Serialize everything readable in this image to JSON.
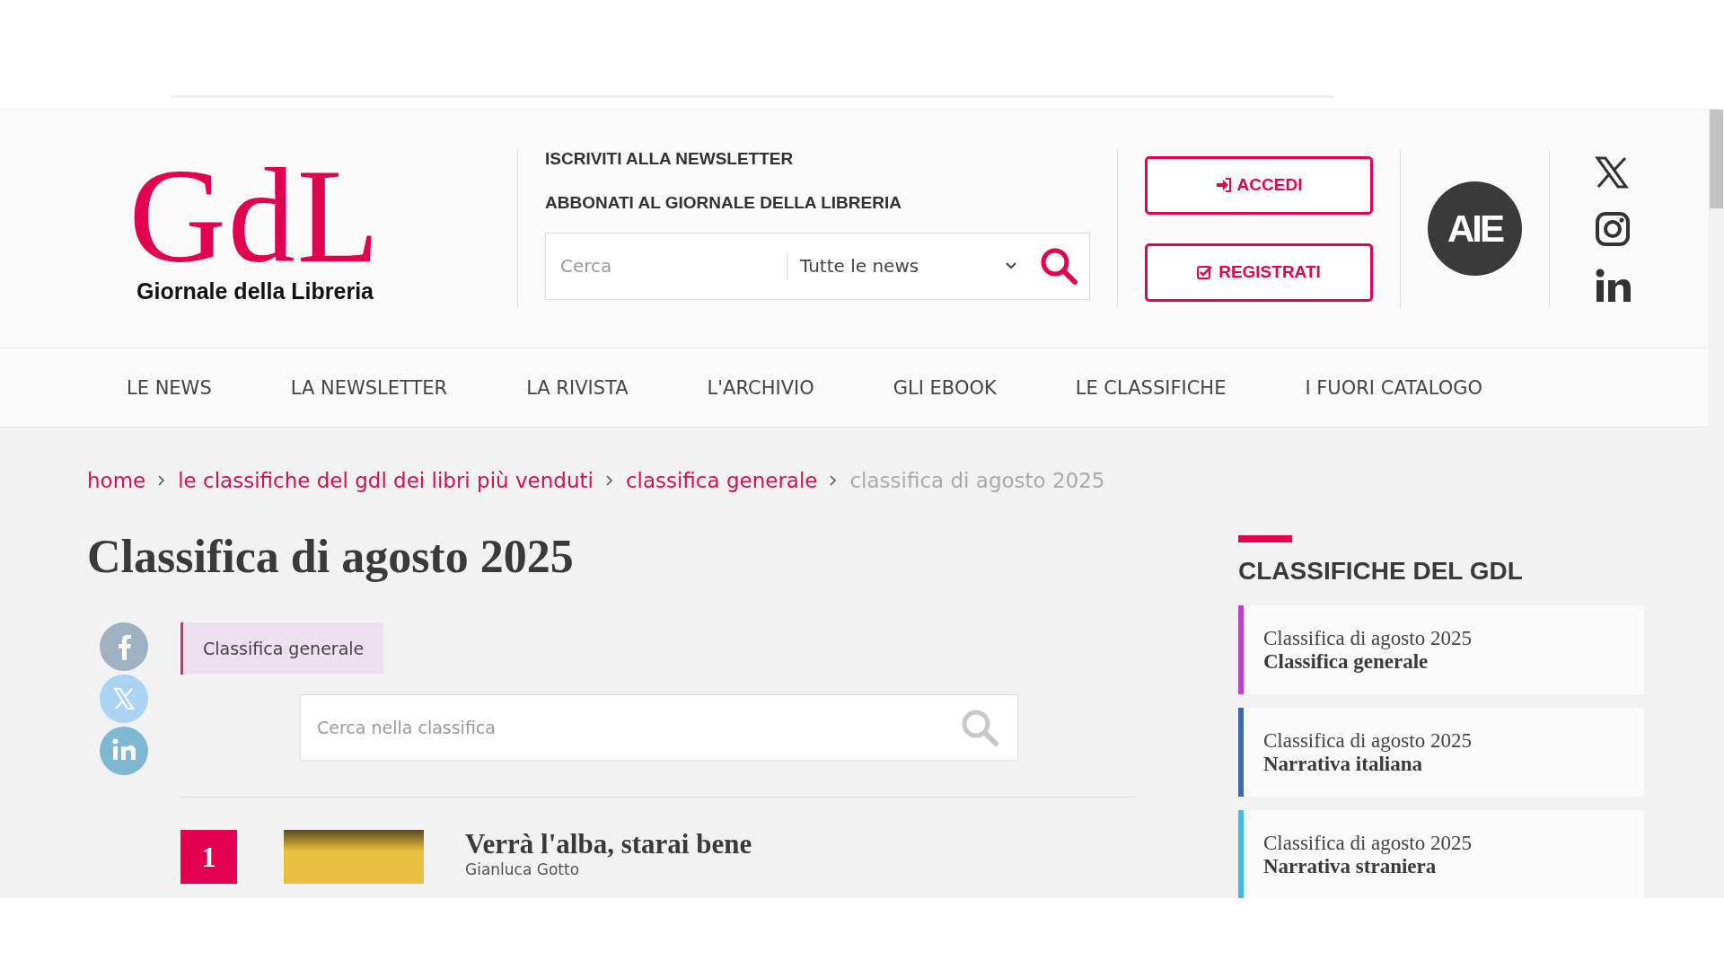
{
  "header": {
    "logo": {
      "letters": "GdL",
      "name": "Giornale della Libreria"
    },
    "links": [
      "ISCRIVITI ALLA NEWSLETTER",
      "ABBONATI AL GIORNALE DELLA LIBRERIA"
    ],
    "search": {
      "placeholder": "Cerca",
      "category": "Tutte le news"
    },
    "buttons": [
      {
        "label": "ACCEDI",
        "kind": "login"
      },
      {
        "label": "REGISTRATI",
        "kind": "register"
      }
    ],
    "partner_logo": "AIE"
  },
  "nav": [
    "LE NEWS",
    "LA NEWSLETTER",
    "LA RIVISTA",
    "L'ARCHIVIO",
    "GLI EBOOK",
    "LE CLASSIFICHE",
    "I FUORI CATALOGO"
  ],
  "breadcrumb": [
    {
      "label": "home",
      "current": false
    },
    {
      "label": "le classifiche del gdl dei libri più venduti",
      "current": false
    },
    {
      "label": "classifica generale",
      "current": false
    },
    {
      "label": "classifica di agosto 2025",
      "current": true
    }
  ],
  "title": "Classifica di agosto 2025",
  "category_tag": "Classifica generale",
  "chart_search": {
    "placeholder": "Cerca nella classifica"
  },
  "entries": [
    {
      "rank": "1",
      "title": "Verrà l'alba, starai bene",
      "author": "Gianluca Gotto"
    }
  ],
  "sidebar": {
    "heading": "CLASSIFICHE DEL GDL",
    "items": [
      {
        "period": "Classifica di agosto 2025",
        "name": "Classifica generale",
        "color": "#c040d0"
      },
      {
        "period": "Classifica di agosto 2025",
        "name": "Narrativa italiana",
        "color": "#3a6ab0"
      },
      {
        "period": "Classifica di agosto 2025",
        "name": "Narrativa straniera",
        "color": "#40c0d8"
      }
    ]
  }
}
